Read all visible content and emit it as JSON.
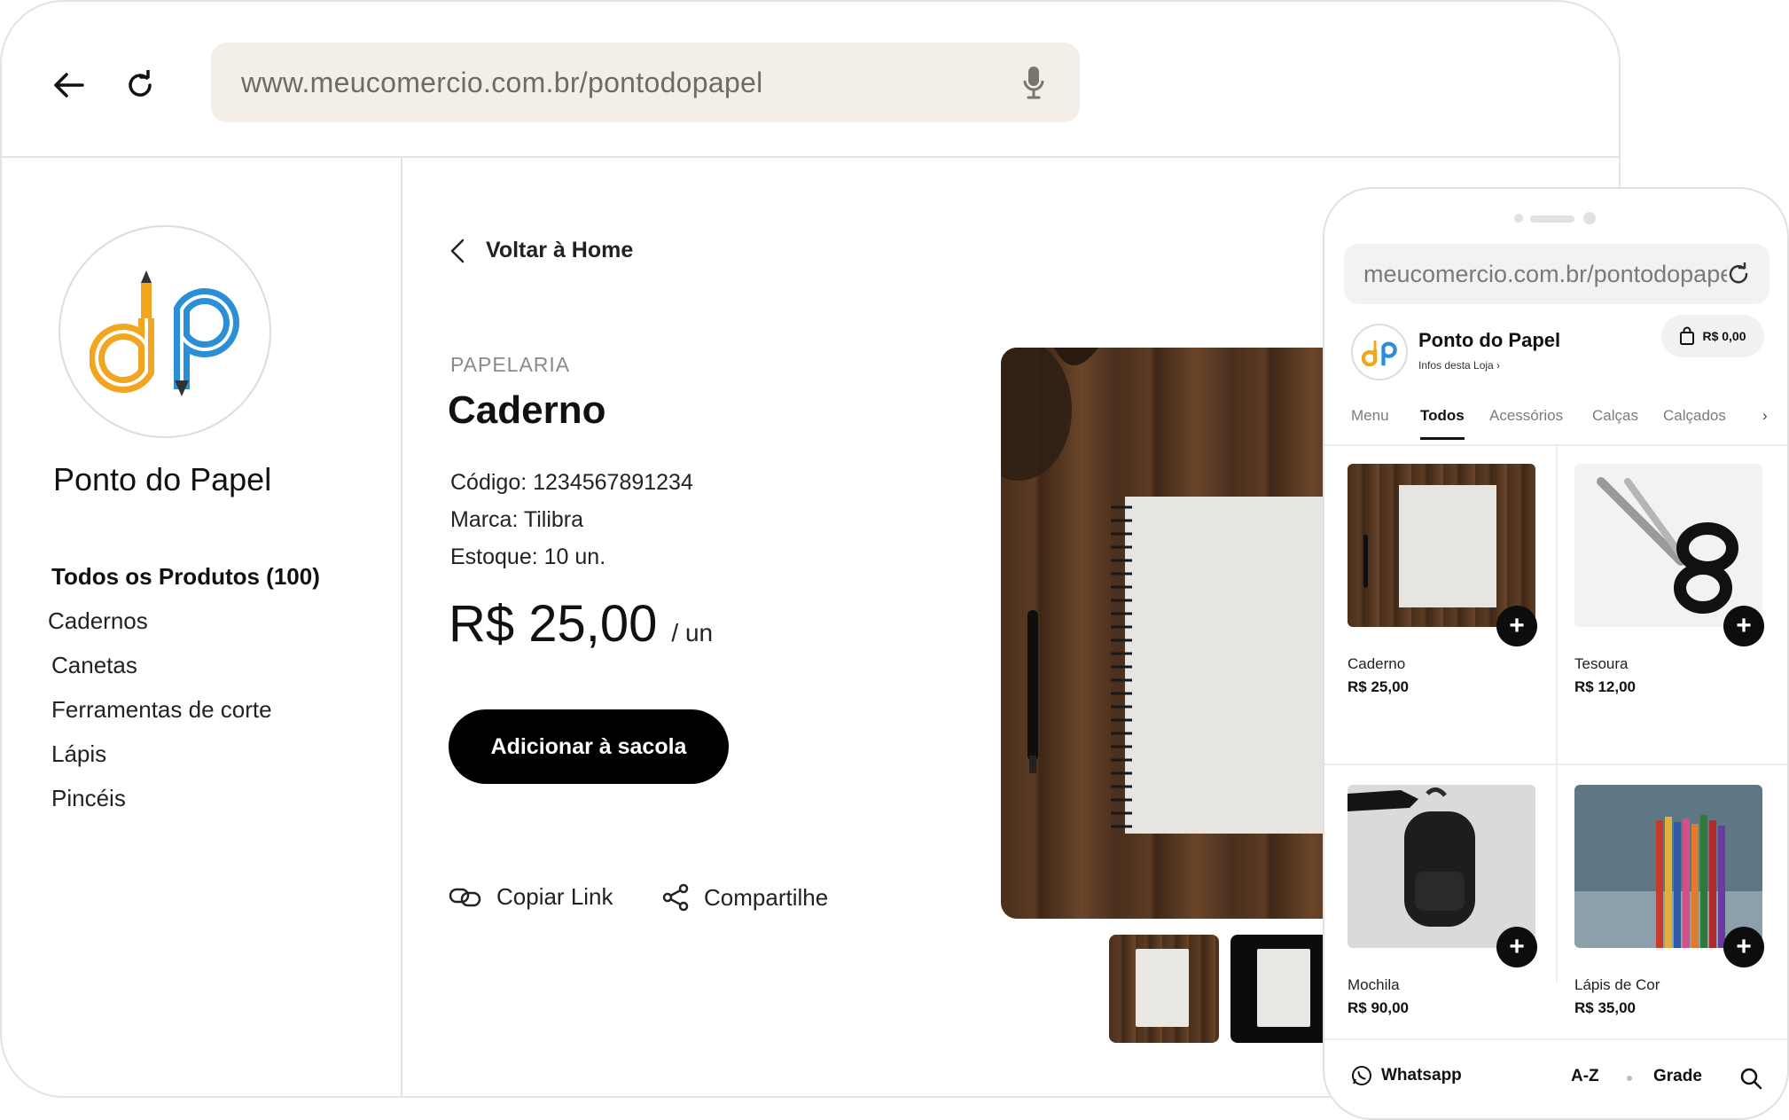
{
  "browser": {
    "url": "www.meucomercio.com.br/pontodopapel"
  },
  "store": {
    "name": "Ponto do Papel",
    "categories": [
      {
        "label": "Todos os Produtos (100)",
        "active": true
      },
      {
        "label": "Cadernos"
      },
      {
        "label": "Canetas"
      },
      {
        "label": "Ferramentas de corte"
      },
      {
        "label": "Lápis"
      },
      {
        "label": "Pincéis"
      }
    ]
  },
  "product": {
    "back_label": "Voltar à Home",
    "category": "PAPELARIA",
    "title": "Caderno",
    "code": "Código: 1234567891234",
    "brand": "Marca: Tilibra",
    "stock": "Estoque: 10 un.",
    "price": "R$ 25,00",
    "unit": "/ un",
    "add_to_bag": "Adicionar à sacola",
    "copy_link": "Copiar Link",
    "share": "Compartilhe"
  },
  "mobile": {
    "url": "meucomercio.com.br/pontodopapel",
    "store_name": "Ponto do Papel",
    "store_info": "Infos desta Loja  ›",
    "cart_total": "R$ 0,00",
    "tabs": [
      "Menu",
      "Todos",
      "Acessórios",
      "Calças",
      "Calçados"
    ],
    "active_tab": "Todos",
    "tab_more": "›",
    "products": [
      {
        "name": "Caderno",
        "price": "R$ 25,00"
      },
      {
        "name": "Tesoura",
        "price": "R$ 12,00"
      },
      {
        "name": "Mochila",
        "price": "R$ 90,00"
      },
      {
        "name": "Lápis de Cor",
        "price": "R$ 35,00"
      }
    ],
    "add_glyph": "+",
    "footer": {
      "whatsapp": "Whatsapp",
      "sort": "A-Z",
      "view": "Grade"
    }
  },
  "colors": {
    "address_bar_bg": "#f4efe6",
    "button_bg": "#000000",
    "logo_orange": "#f2a51f",
    "logo_blue": "#2b8fd6"
  }
}
